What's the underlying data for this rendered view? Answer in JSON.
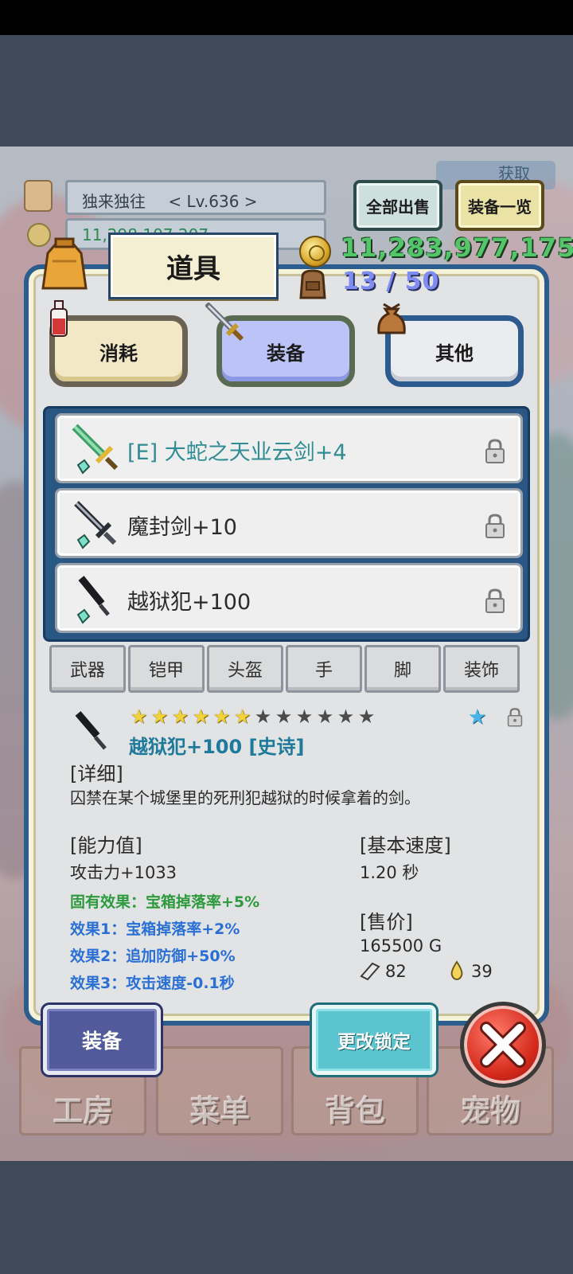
{
  "header": {
    "player_name": "独来独往",
    "player_level": "< Lv.636 >",
    "gold_partial": "11,298,107,207",
    "sell_all_label": "全部出售",
    "equipment_list_label": "装备一览",
    "get_label": "获取"
  },
  "panel": {
    "title": "道具",
    "gold": "11,283,977,175",
    "capacity": "13 / 50"
  },
  "categories": [
    {
      "label": "消耗"
    },
    {
      "label": "装备"
    },
    {
      "label": "其他"
    }
  ],
  "items": [
    {
      "name": "[E] 大蛇之天业云剑+4",
      "equipped": true
    },
    {
      "name": "魔封剑+10",
      "equipped": false
    },
    {
      "name": "越狱犯+100",
      "equipped": false
    }
  ],
  "filters": [
    "武器",
    "铠甲",
    "头盔",
    "手",
    "脚",
    "装饰"
  ],
  "detail": {
    "stars_filled": 6,
    "stars_total": 12,
    "name": "越狱犯+100 [史诗]",
    "detail_title": "[详细]",
    "description": "囚禁在某个城堡里的死刑犯越狱的时候拿着的剑。",
    "stats_title": "[能力值]",
    "attack": "攻击力+1033",
    "inherent_effect": "固有效果：宝箱掉落率+5%",
    "effect1": "效果1：宝箱掉落率+2%",
    "effect2": "效果2：追加防御+50%",
    "effect3": "效果3：攻击速度-0.1秒",
    "speed_title": "[基本速度]",
    "speed": "1.20 秒",
    "price_title": "[售价]",
    "price": "165500 G",
    "material_count": "82",
    "drop_count": "39"
  },
  "actions": {
    "equip_label": "装备",
    "change_lock_label": "更改锁定"
  },
  "nav": [
    "工房",
    "菜单",
    "背包",
    "宠物"
  ],
  "colors": {
    "panel_border": "#2c5d8f",
    "gold_text": "#53c66a",
    "capacity_text": "#7f8cf2",
    "equipped_name": "#2f8d93",
    "detail_name": "#1e7a9a",
    "inherent_effect": "#2e9a3e",
    "effect": "#2a6fd6"
  }
}
